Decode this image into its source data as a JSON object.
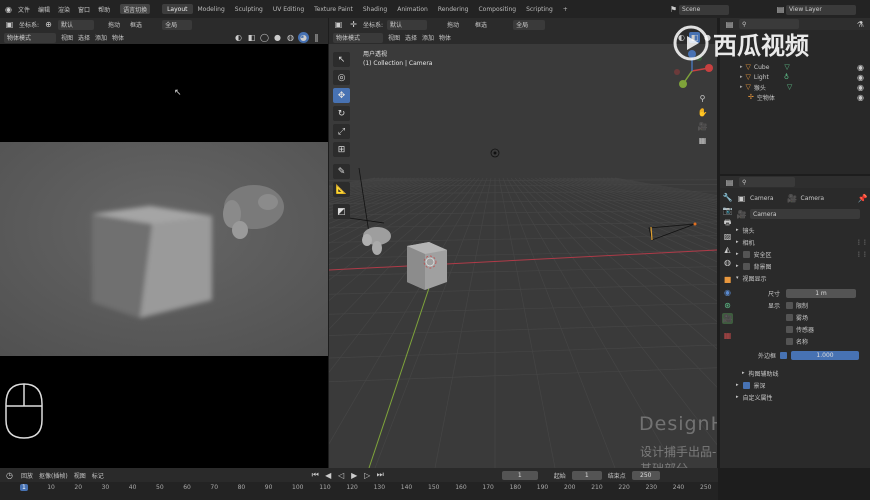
{
  "topbar": {
    "menus": [
      "文件",
      "编辑",
      "渲染",
      "窗口",
      "帮助"
    ],
    "workspace_switch": "语言切换",
    "tabs": [
      "Layout",
      "Modeling",
      "Sculpting",
      "UV Editing",
      "Texture Paint",
      "Shading",
      "Animation",
      "Rendering",
      "Compositing",
      "Scripting"
    ],
    "add_tab": "+",
    "scene": "Scene",
    "view_layer": "View Layer"
  },
  "left_header": {
    "coord_label": "坐标系:",
    "coord_value": "默认",
    "drag_label": "拖动",
    "select_label": "框选",
    "global": "全局",
    "mode": "物体模式",
    "menus": [
      "视图",
      "选择",
      "添加",
      "物体"
    ]
  },
  "viewport": {
    "coord_label": "坐标系:",
    "coord_value": "默认",
    "drag_label": "拖动",
    "select_label": "框选",
    "global": "全局",
    "mode": "物体模式",
    "menus": [
      "视图",
      "选择",
      "添加",
      "物体"
    ],
    "overlay_title": "用户透视",
    "overlay_sub": "(1) Collection | Camera",
    "watermark_1": "DesignHunting",
    "watermark_2": "设计捕手出品-基础部分"
  },
  "outliner": {
    "items": [
      {
        "name": "Cube"
      },
      {
        "name": "Light"
      },
      {
        "name": "猴头"
      },
      {
        "name": "空物体"
      }
    ]
  },
  "brand_watermark": "西瓜视频",
  "properties": {
    "breadcrumb_a": "Camera",
    "breadcrumb_b": "Camera",
    "datablock": "Camera",
    "sections": {
      "lens": "镜头",
      "camera": "相机",
      "safe_areas": "安全区",
      "background": "背景图",
      "viewport_display": "视图显示",
      "size_label": "尺寸",
      "size_value": "1 m",
      "show_label": "显示",
      "opt_limits": "限制",
      "opt_mist": "雾场",
      "opt_sensor": "传感器",
      "opt_name": "名称",
      "passepartout_label": "外边框",
      "passepartout_value": "1.000",
      "composition_guides": "构图辅助线",
      "dof": "景深",
      "custom_props": "自定义属性"
    }
  },
  "timeline": {
    "menus": [
      "回放",
      "抠像(插帧)",
      "视图",
      "标记"
    ],
    "current_frame": "1",
    "start_label": "起始",
    "start_value": "1",
    "end_label": "结束点",
    "end_value": "250",
    "ticks": [
      "1",
      "10",
      "20",
      "30",
      "40",
      "50",
      "60",
      "70",
      "80",
      "90",
      "100",
      "110",
      "120",
      "130",
      "140",
      "150",
      "160",
      "170",
      "180",
      "190",
      "200",
      "210",
      "220",
      "230",
      "240",
      "250"
    ]
  },
  "colors": {
    "accent": "#4772b3",
    "x_axis": "#b03a48",
    "y_axis": "#7ea33a",
    "grid": "#454545"
  }
}
